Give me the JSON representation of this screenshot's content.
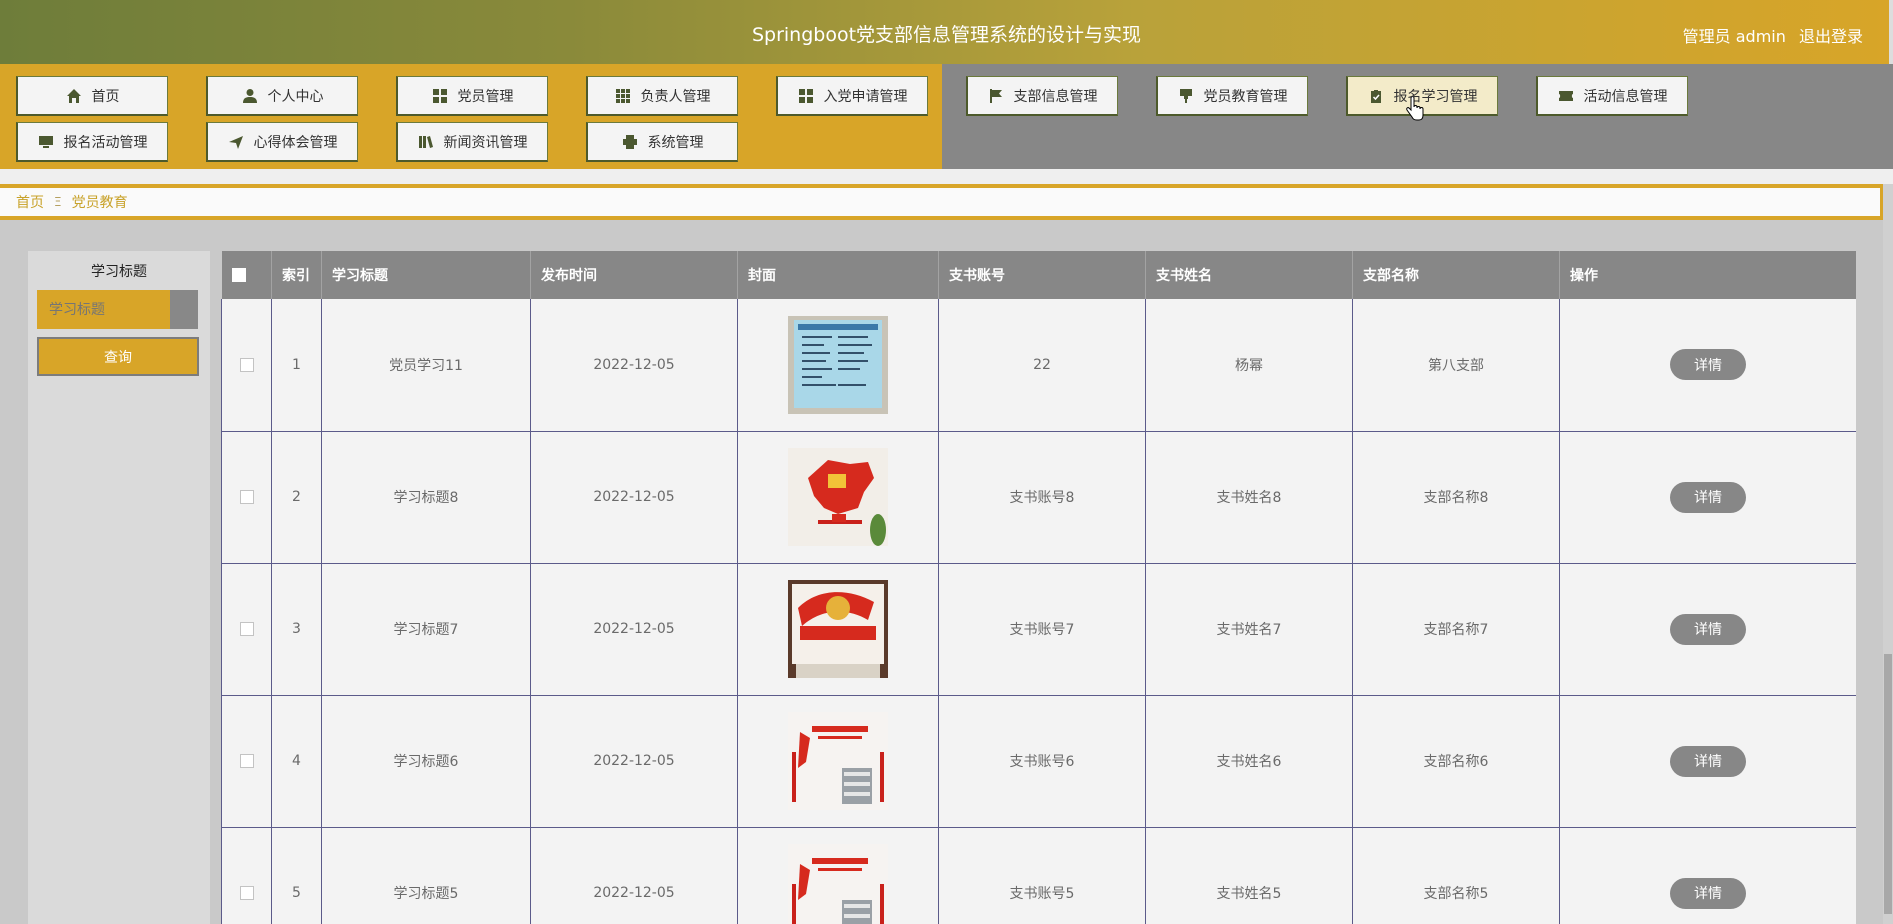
{
  "header": {
    "title": "Springboot党支部信息管理系统的设计与实现",
    "user_label": "管理员 admin",
    "logout": "退出登录"
  },
  "nav": {
    "items": [
      {
        "label": "首页",
        "icon": "home-icon"
      },
      {
        "label": "个人中心",
        "icon": "user-icon"
      },
      {
        "label": "党员管理",
        "icon": "grid-icon"
      },
      {
        "label": "负责人管理",
        "icon": "grid9-icon"
      },
      {
        "label": "入党申请管理",
        "icon": "grid-icon"
      },
      {
        "label": "支部信息管理",
        "icon": "flag-icon"
      },
      {
        "label": "党员教育管理",
        "icon": "pin-icon"
      },
      {
        "label": "报名学习管理",
        "icon": "clipboard-icon"
      },
      {
        "label": "活动信息管理",
        "icon": "ticket-icon"
      },
      {
        "label": "报名活动管理",
        "icon": "monitor-icon"
      },
      {
        "label": "心得体会管理",
        "icon": "send-icon"
      },
      {
        "label": "新闻资讯管理",
        "icon": "book-icon"
      },
      {
        "label": "系统管理",
        "icon": "printer-icon"
      }
    ],
    "active": "报名学习管理"
  },
  "breadcrumb": {
    "home": "首页",
    "sep": "Ξ",
    "current": "党员教育"
  },
  "search": {
    "label": "学习标题",
    "placeholder": "学习标题",
    "button": "查询"
  },
  "table": {
    "columns": [
      "",
      "索引",
      "学习标题",
      "发布时间",
      "封面",
      "支书账号",
      "支书姓名",
      "支部名称",
      "操作"
    ],
    "rows": [
      {
        "index": "1",
        "title": "党员学习11",
        "date": "2022-12-05",
        "cover": "document-board",
        "account": "22",
        "name": "杨幂",
        "branch": "第八支部",
        "action": "详情"
      },
      {
        "index": "2",
        "title": "学习标题8",
        "date": "2022-12-05",
        "cover": "china-map",
        "account": "支书账号8",
        "name": "支书姓名8",
        "branch": "支部名称8",
        "action": "详情"
      },
      {
        "index": "3",
        "title": "学习标题7",
        "date": "2022-12-05",
        "cover": "red-banner",
        "account": "支书账号7",
        "name": "支书姓名7",
        "branch": "支部名称7",
        "action": "详情"
      },
      {
        "index": "4",
        "title": "学习标题6",
        "date": "2022-12-05",
        "cover": "party-room",
        "account": "支书账号6",
        "name": "支书姓名6",
        "branch": "支部名称6",
        "action": "详情"
      },
      {
        "index": "5",
        "title": "学习标题5",
        "date": "2022-12-05",
        "cover": "party-room",
        "account": "支书账号5",
        "name": "支书姓名5",
        "branch": "支部名称5",
        "action": "详情"
      }
    ]
  },
  "colors": {
    "gold": "#d8a528",
    "gray": "#878787",
    "olive": "#6e7d3a"
  }
}
